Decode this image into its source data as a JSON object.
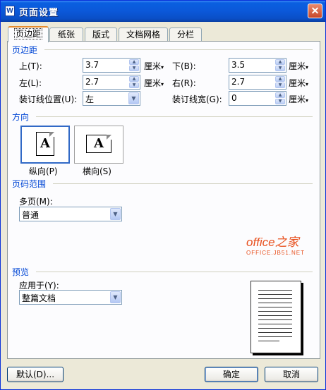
{
  "window": {
    "title": "页面设置",
    "app_icon": "W"
  },
  "tabs": [
    {
      "label": "页边距",
      "active": true
    },
    {
      "label": "纸张"
    },
    {
      "label": "版式"
    },
    {
      "label": "文档网格"
    },
    {
      "label": "分栏"
    }
  ],
  "margins": {
    "section_title": "页边距",
    "top": {
      "label": "上(T):",
      "value": "3.7",
      "unit": "厘米"
    },
    "bottom": {
      "label": "下(B):",
      "value": "3.5",
      "unit": "厘米"
    },
    "left": {
      "label": "左(L):",
      "value": "2.7",
      "unit": "厘米"
    },
    "right": {
      "label": "右(R):",
      "value": "2.7",
      "unit": "厘米"
    },
    "gutter_position": {
      "label": "装订线位置(U):",
      "value": "左"
    },
    "gutter_width": {
      "label": "装订线宽(G):",
      "value": "0",
      "unit": "厘米"
    }
  },
  "orientation": {
    "section_title": "方向",
    "portrait": {
      "label": "纵向(P)",
      "glyph": "A",
      "selected": true
    },
    "landscape": {
      "label": "横向(S)",
      "glyph": "A"
    }
  },
  "page_range": {
    "section_title": "页码范围",
    "multiple_pages_label": "多页(M):",
    "multiple_pages_value": "普通"
  },
  "watermark": {
    "main": "office之家",
    "sub": "OFFICE.JB51.NET"
  },
  "preview": {
    "section_title": "预览",
    "apply_to_label": "应用于(Y):",
    "apply_to_value": "整篇文档"
  },
  "buttons": {
    "default": "默认(D)...",
    "ok": "确定",
    "cancel": "取消"
  },
  "colors": {
    "titlebar": "#0b58d9",
    "section_label": "#0046d5",
    "brand": "#e8501e"
  }
}
